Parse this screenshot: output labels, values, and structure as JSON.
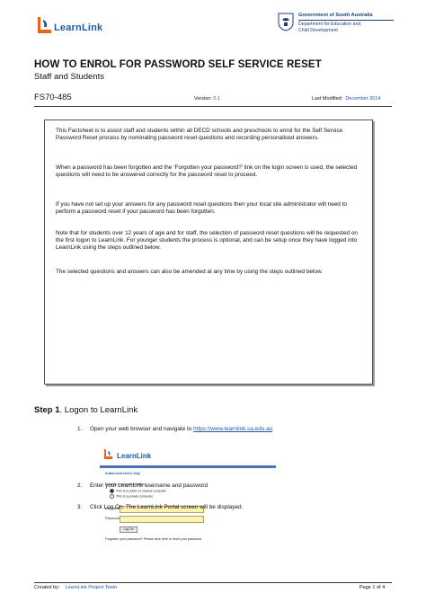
{
  "header": {
    "logo_text": "LearnLink",
    "gov_line1": "Government of South Australia",
    "gov_line2a": "Department for Education and",
    "gov_line2b": "Child Development"
  },
  "title": "HOW TO ENROL FOR PASSWORD SELF SERVICE RESET",
  "subtitle": "Staff and Students",
  "doc_id": "FS70-485",
  "version_label": "Version:",
  "version_value": "0.1",
  "modified_label": "Last Modified:",
  "modified_value": "December 2014",
  "factsheet": {
    "p1": "This Factsheet is to assist staff and students within all DECD schools and preschools to enrol for the Self Service Password Reset process by nominating password reset questions and recording personalised answers.",
    "p2": "When a password has been forgotten and the ‘Forgotten your password?’ link on the login screen is used, the selected questions will need to be answered correctly for the password reset to proceed.",
    "p3": "If you have not set up your answers for any password reset questions then your local site administrator will need to perform a password reset if your password has been forgotten.",
    "p4": "Note that for students over 12 years of age and for staff, the selection of password reset questions will be requested on the first logon to LearnLink. For younger students the process is optional, and can be setup once they have logged into LearnLink using the steps outlined below.",
    "p5": "The selected questions and answers can also be amended at any time by using the steps outlined below."
  },
  "step1": {
    "prefix": "Step 1",
    "title": ". Logon to LearnLink"
  },
  "steps": [
    {
      "num": "1.",
      "text": "Open your web browser and navigate to ",
      "link": "https://www.learnlink.sa.edu.au"
    },
    {
      "num": "2.",
      "text": "Enter your LearnLink username and password"
    },
    {
      "num": "3.",
      "text": "Click Log On.  The LearnLink Portal screen will be displayed."
    }
  ],
  "login_shot": {
    "logo_text": "LearnLink",
    "heading": "Authorised Users Only",
    "security_label": "Security ( show explanation )",
    "option_public": "This is a public or shared computer",
    "option_private": "This is a private computer",
    "username_label": "Username:",
    "password_label": "Password:",
    "logon_button": "Log On",
    "forgot_text": "Forgotten your password?  Please click here to reset your password."
  },
  "footer": {
    "created_label": "Created by:",
    "created_value": "LearnLink Project Team",
    "page_label": "Page 1 of 4"
  },
  "colors": {
    "brand_blue": "#1c5aa6",
    "gov_navy": "#1e3f78",
    "logo_orange": "#e8641e",
    "field_yellow": "#fbf3b3"
  }
}
